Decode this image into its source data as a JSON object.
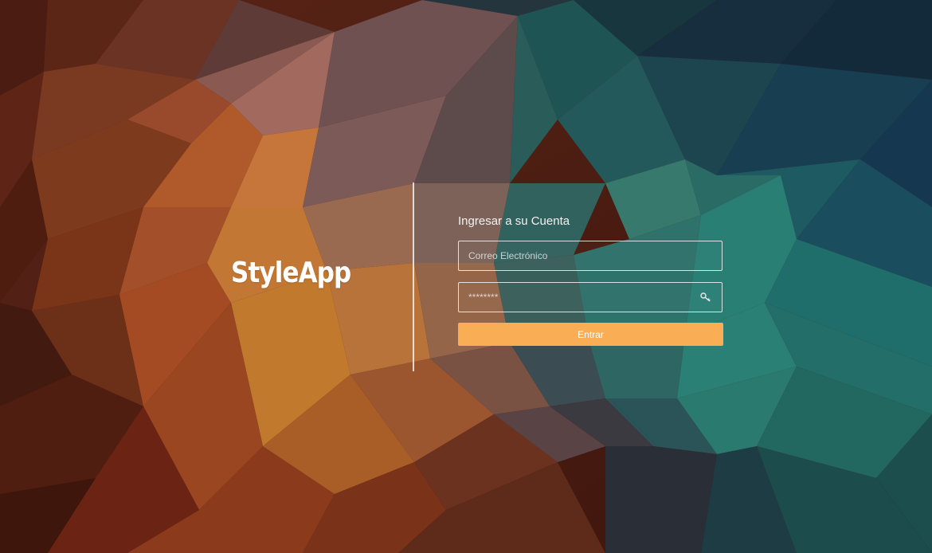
{
  "brand": {
    "name": "StyleApp"
  },
  "login": {
    "title": "Ingresar a su Cuenta",
    "email_placeholder": "Correo Electrónico",
    "password_placeholder": "********",
    "submit_label": "Entrar"
  },
  "icons": {
    "password_field": "key-icon"
  },
  "colors": {
    "accent": "#f9ae56",
    "text": "#ffffff"
  }
}
